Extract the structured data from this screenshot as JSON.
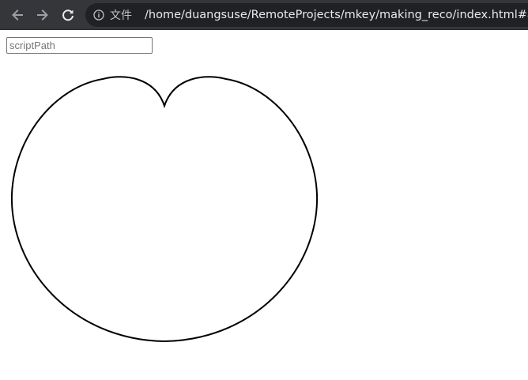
{
  "browser": {
    "back_icon": "arrow-left-icon",
    "forward_icon": "arrow-right-icon",
    "reload_icon": "reload-icon",
    "info_icon": "info-icon",
    "file_label": "文件",
    "url": "/home/duangsuse/RemoteProjects/mkey/making_reco/index.html#a"
  },
  "page": {
    "script_path_value": "",
    "script_path_placeholder": "scriptPath"
  },
  "drawing": {
    "shape": "heart-curve",
    "stroke_color": "#000000"
  }
}
